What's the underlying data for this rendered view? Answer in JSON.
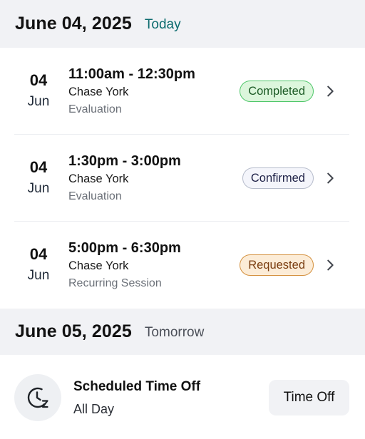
{
  "days": [
    {
      "date": "June 04, 2025",
      "relative": "Today",
      "appointments": [
        {
          "day": "04",
          "month": "Jun",
          "time": "11:00am - 12:30pm",
          "client": "Chase York",
          "type": "Evaluation",
          "status": "Completed"
        },
        {
          "day": "04",
          "month": "Jun",
          "time": "1:30pm - 3:00pm",
          "client": "Chase York",
          "type": "Evaluation",
          "status": "Confirmed"
        },
        {
          "day": "04",
          "month": "Jun",
          "time": "5:00pm - 6:30pm",
          "client": "Chase York",
          "type": "Recurring Session",
          "status": "Requested"
        }
      ]
    },
    {
      "date": "June 05, 2025",
      "relative": "Tomorrow",
      "time_off": {
        "icon": "clock-snooze-icon",
        "title": "Scheduled Time Off",
        "subtitle": "All Day",
        "button_label": "Time Off"
      }
    }
  ],
  "icons": {
    "row_action": "chevron-right-icon"
  },
  "colors": {
    "today": "#0c6b6e",
    "completed_bg": "#dcf6dc",
    "completed_border": "#4fc76a",
    "confirmed_border": "#b6bccb",
    "requested_bg": "#fcecd7",
    "requested_border": "#d4913f",
    "header_bg": "#f1f2f5"
  }
}
